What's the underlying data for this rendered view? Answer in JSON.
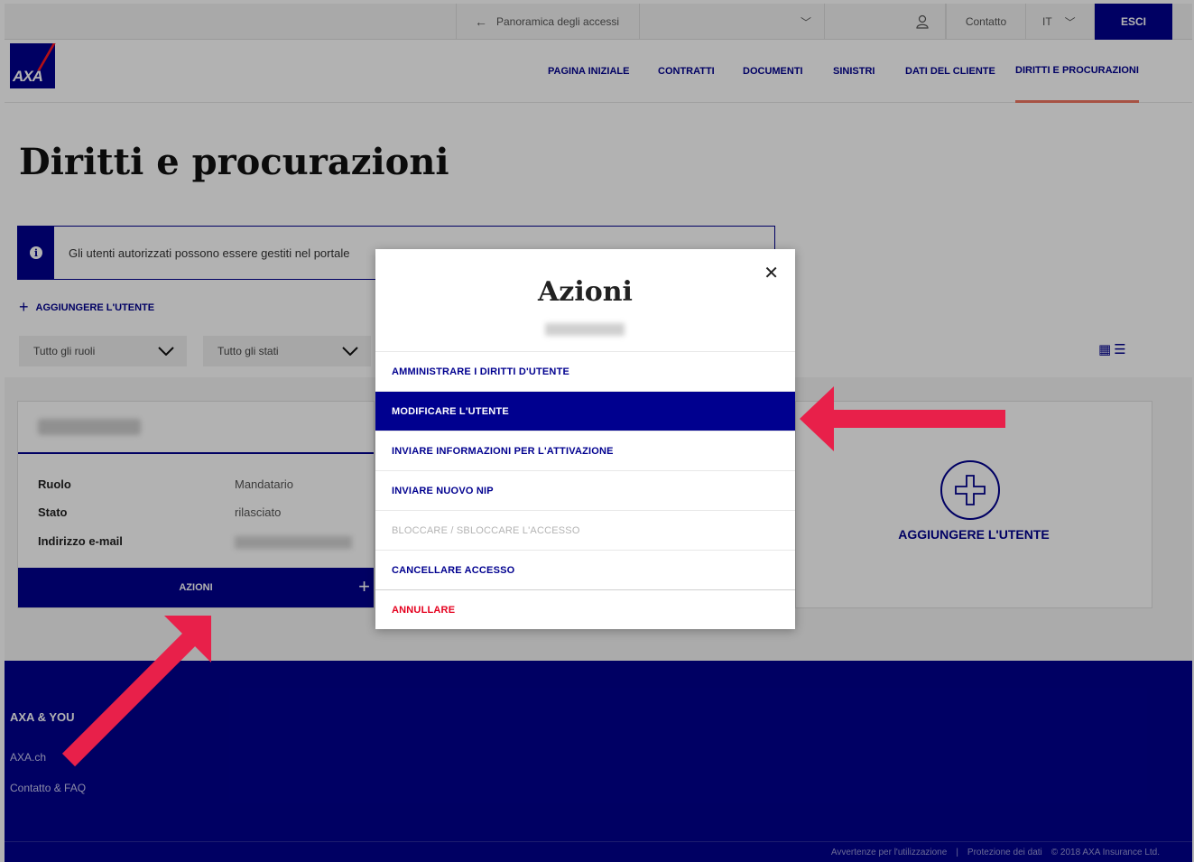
{
  "topbar": {
    "back_label": "Panoramica degli accessi",
    "contact_label": "Contatto",
    "lang_label": "IT",
    "logout_label": "ESCI"
  },
  "brand": {
    "logo_text": "AXA"
  },
  "nav": {
    "items": [
      "PAGINA INIZIALE",
      "CONTRATTI",
      "DOCUMENTI",
      "SINISTRI",
      "DATI DEL CLIENTE",
      "DIRITTI E PROCURAZIONI"
    ],
    "active": "DIRITTI E PROCURAZIONI"
  },
  "page": {
    "title": "Diritti e procurazioni",
    "info_text": "Gli utenti autorizzati possono essere gestiti nel portale",
    "add_user_link": "AGGIUNGERE L'UTENTE"
  },
  "filters": {
    "roles": "Tutto gli ruoli",
    "states": "Tutto gli stati"
  },
  "user_card": {
    "role_label": "Ruolo",
    "role_value": "Mandatario",
    "state_label": "Stato",
    "state_value": "rilasciato",
    "email_label": "Indirizzo e-mail",
    "actions_label": "AZIONI"
  },
  "add_card": {
    "label": "AGGIUNGERE L'UTENTE"
  },
  "footer": {
    "title": "AXA & YOU",
    "links": [
      "AXA.ch",
      "Contatto & FAQ"
    ],
    "bottom": [
      "Avvertenze per l'utilizzazione",
      "|",
      "Protezione dei dati",
      "© 2018 AXA Insurance Ltd."
    ]
  },
  "modal": {
    "title": "Azioni",
    "items": [
      {
        "label": "AMMINISTRARE I DIRITTI D'UTENTE",
        "state": "normal"
      },
      {
        "label": "MODIFICARE L'UTENTE",
        "state": "active"
      },
      {
        "label": "INVIARE INFORMAZIONI PER L'ATTIVAZIONE",
        "state": "normal"
      },
      {
        "label": "INVIARE NUOVO NIP",
        "state": "normal"
      },
      {
        "label": "BLOCCARE / SBLOCCARE L'ACCESSO",
        "state": "disabled"
      },
      {
        "label": "CANCELLARE ACCESSO",
        "state": "normal"
      }
    ],
    "cancel_label": "ANNULLARE"
  },
  "colors": {
    "brand": "#00008f",
    "accent": "#f07662",
    "danger": "#e5001e",
    "annotation": "#e8204a"
  }
}
